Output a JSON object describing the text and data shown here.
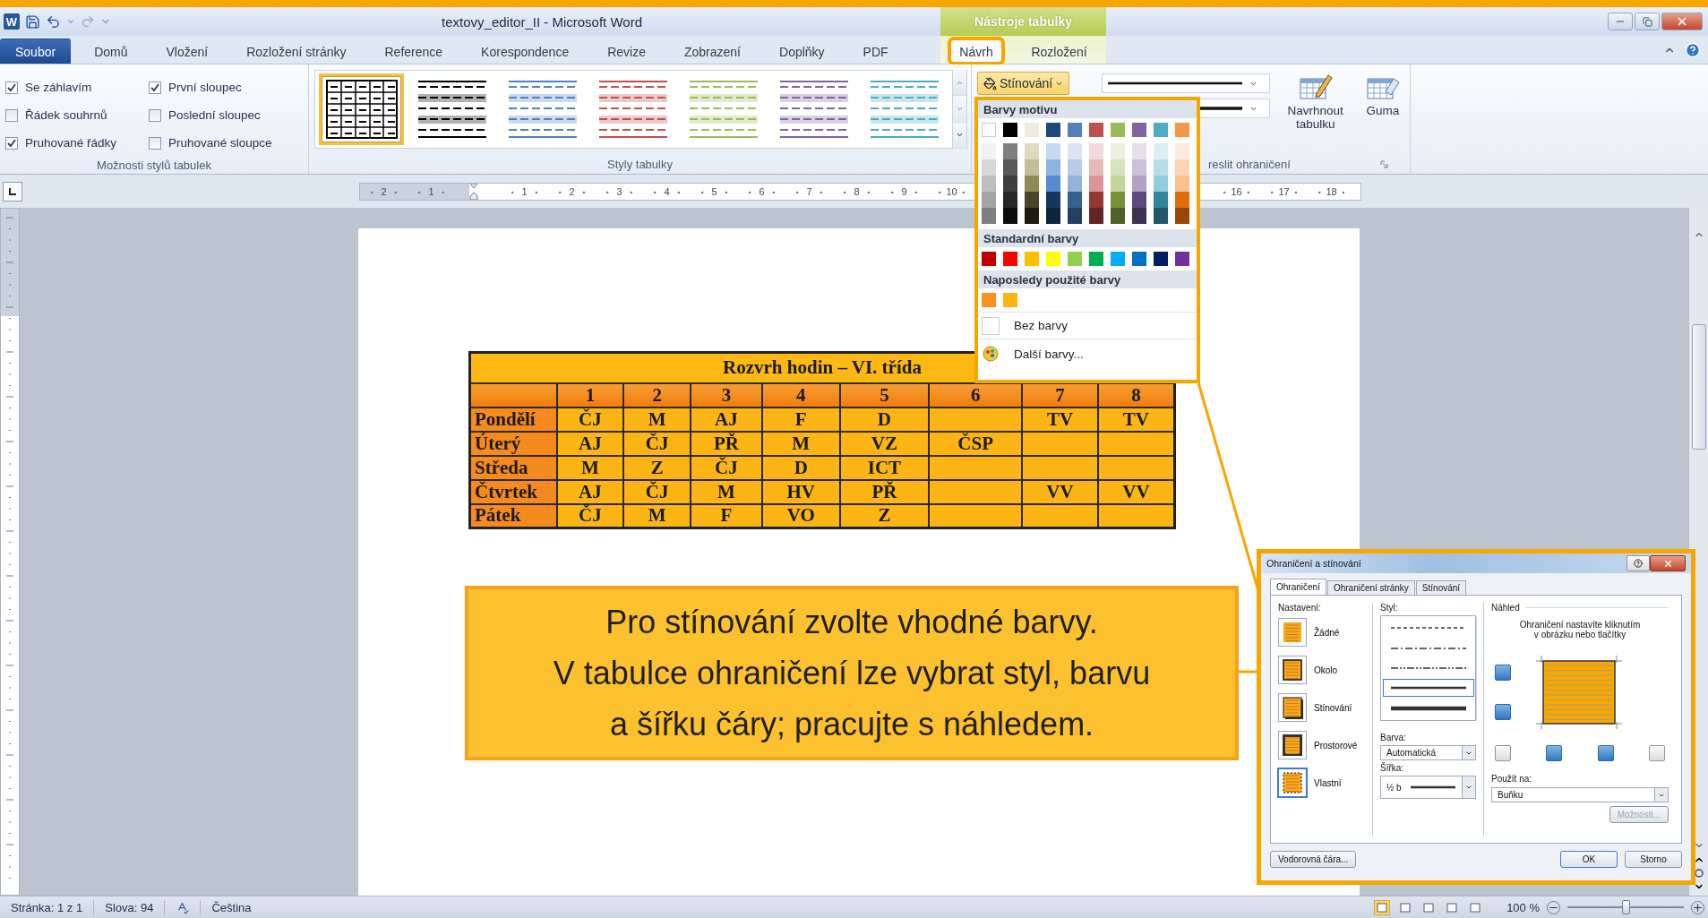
{
  "title_bar": {
    "app_letter": "W",
    "title": "textovy_editor_II - Microsoft Word",
    "context_tab": "Nástroje tabulky"
  },
  "tabs": [
    {
      "label": "Soubor",
      "kind": "file",
      "selected": false,
      "highlighted": false
    },
    {
      "label": "Domů",
      "kind": "main",
      "selected": false,
      "highlighted": false
    },
    {
      "label": "Vložení",
      "kind": "main",
      "selected": false,
      "highlighted": false
    },
    {
      "label": "Rozložení stránky",
      "kind": "main",
      "selected": false,
      "highlighted": false
    },
    {
      "label": "Reference",
      "kind": "main",
      "selected": false,
      "highlighted": false
    },
    {
      "label": "Korespondence",
      "kind": "main",
      "selected": false,
      "highlighted": false
    },
    {
      "label": "Revize",
      "kind": "main",
      "selected": false,
      "highlighted": false
    },
    {
      "label": "Zobrazení",
      "kind": "main",
      "selected": false,
      "highlighted": false
    },
    {
      "label": "Doplňky",
      "kind": "main",
      "selected": false,
      "highlighted": false
    },
    {
      "label": "PDF",
      "kind": "main",
      "selected": false,
      "highlighted": false
    },
    {
      "label": "Návrh",
      "kind": "context",
      "selected": true,
      "highlighted": true
    },
    {
      "label": "Rozložení",
      "kind": "context",
      "selected": false,
      "highlighted": false
    }
  ],
  "ribbon": {
    "style_options": {
      "label": "Možnosti stylů tabulek",
      "options": [
        {
          "label": "Se záhlavím",
          "checked": true
        },
        {
          "label": "Řádek souhrnů",
          "checked": false
        },
        {
          "label": "Pruhované řádky",
          "checked": true
        },
        {
          "label": "První sloupec",
          "checked": true
        },
        {
          "label": "Poslední sloupec",
          "checked": false
        },
        {
          "label": "Pruhované sloupce",
          "checked": false
        }
      ]
    },
    "table_styles": {
      "label": "Styly tabulky",
      "items": [
        {
          "kind": "grid",
          "color": "#000000",
          "selected": true
        },
        {
          "kind": "banded",
          "color": "#000000",
          "selected": false
        },
        {
          "kind": "banded",
          "color": "#4f81bd",
          "selected": false
        },
        {
          "kind": "banded",
          "color": "#c0504d",
          "selected": false
        },
        {
          "kind": "banded",
          "color": "#9bbb59",
          "selected": false
        },
        {
          "kind": "banded",
          "color": "#8064a2",
          "selected": false
        },
        {
          "kind": "banded",
          "color": "#4bacc6",
          "selected": false
        }
      ]
    },
    "borders": {
      "shading_button": {
        "label": "Stínování",
        "open": true
      },
      "buttons": [
        {
          "label": "Navrhnout tabulku",
          "kind": "draw"
        },
        {
          "label": "Guma",
          "kind": "eraser"
        }
      ],
      "label": "reslit ohraničení"
    }
  },
  "ruler": {
    "left_labels": [
      "2",
      "1"
    ],
    "labels": [
      "1",
      "2",
      "3",
      "4",
      "5",
      "6",
      "7",
      "8",
      "9",
      "10"
    ],
    "right_labels": [
      "16",
      "17",
      "18"
    ]
  },
  "document_table": {
    "title": "Rozvrh hodin – VI. třída",
    "columns": [
      "1",
      "2",
      "3",
      "4",
      "5",
      "6",
      "7",
      "8"
    ],
    "rows": [
      {
        "day": "Pondělí",
        "cells": [
          "ČJ",
          "M",
          "AJ",
          "F",
          "D",
          null,
          "TV",
          "TV"
        ]
      },
      {
        "day": "Úterý",
        "cells": [
          "AJ",
          "ČJ",
          "PŘ",
          "M",
          "VZ",
          "ČSP",
          null,
          null
        ]
      },
      {
        "day": "Středa",
        "cells": [
          "M",
          "Z",
          "ČJ",
          "D",
          "ICT",
          null,
          null,
          null
        ]
      },
      {
        "day": "Čtvrtek",
        "cells": [
          "AJ",
          "ČJ",
          "M",
          "HV",
          "PŘ",
          null,
          "VV",
          "VV"
        ]
      },
      {
        "day": "Pátek",
        "cells": [
          "ČJ",
          "M",
          "F",
          "VO",
          "Z",
          null,
          null,
          null
        ]
      }
    ]
  },
  "color_dropdown": {
    "theme_title": "Barvy motivu",
    "theme_colors": [
      {
        "color": "#ffffff",
        "shades": [
          {
            "color": "#f2f2f2"
          },
          {
            "color": "#d8d8d8"
          },
          {
            "color": "#bfbfbf"
          },
          {
            "color": "#a5a5a5"
          },
          {
            "color": "#7f7f7f"
          }
        ]
      },
      {
        "color": "#000000",
        "shades": [
          {
            "color": "#7f7f7f"
          },
          {
            "color": "#595959"
          },
          {
            "color": "#3f3f3f"
          },
          {
            "color": "#262626"
          },
          {
            "color": "#0c0c0c"
          }
        ]
      },
      {
        "color": "#eeece1",
        "shades": [
          {
            "color": "#ddd9c3"
          },
          {
            "color": "#c4bd97"
          },
          {
            "color": "#938953"
          },
          {
            "color": "#494429"
          },
          {
            "color": "#1d1b10"
          }
        ]
      },
      {
        "color": "#1f497d",
        "shades": [
          {
            "color": "#c6d9f0"
          },
          {
            "color": "#8db3e2"
          },
          {
            "color": "#548dd4"
          },
          {
            "color": "#17365d"
          },
          {
            "color": "#0f243e"
          }
        ]
      },
      {
        "color": "#4f81bd",
        "shades": [
          {
            "color": "#dbe5f1"
          },
          {
            "color": "#b8cce4"
          },
          {
            "color": "#95b3d7"
          },
          {
            "color": "#366092"
          },
          {
            "color": "#244061"
          }
        ]
      },
      {
        "color": "#c0504d",
        "shades": [
          {
            "color": "#f2dcdb"
          },
          {
            "color": "#e5b9b7"
          },
          {
            "color": "#d99694"
          },
          {
            "color": "#953734"
          },
          {
            "color": "#632423"
          }
        ]
      },
      {
        "color": "#9bbb59",
        "shades": [
          {
            "color": "#ebf1dd"
          },
          {
            "color": "#d7e3bc"
          },
          {
            "color": "#c3d69b"
          },
          {
            "color": "#76923c"
          },
          {
            "color": "#4f6128"
          }
        ]
      },
      {
        "color": "#8064a2",
        "shades": [
          {
            "color": "#e5e0ec"
          },
          {
            "color": "#ccc1d9"
          },
          {
            "color": "#b2a2c7"
          },
          {
            "color": "#5f497a"
          },
          {
            "color": "#3f3151"
          }
        ]
      },
      {
        "color": "#4bacc6",
        "shades": [
          {
            "color": "#dbeef3"
          },
          {
            "color": "#b7dde8"
          },
          {
            "color": "#92cddc"
          },
          {
            "color": "#31859b"
          },
          {
            "color": "#205867"
          }
        ]
      },
      {
        "color": "#f79646",
        "shades": [
          {
            "color": "#fdeada"
          },
          {
            "color": "#fbd5b5"
          },
          {
            "color": "#fac08f"
          },
          {
            "color": "#e36c09"
          },
          {
            "color": "#974806"
          }
        ]
      }
    ],
    "standard_title": "Standardní barvy",
    "standard_colors": [
      {
        "color": "#c00000"
      },
      {
        "color": "#ff0000"
      },
      {
        "color": "#ffc000"
      },
      {
        "color": "#ffff00"
      },
      {
        "color": "#92d050"
      },
      {
        "color": "#00b050"
      },
      {
        "color": "#00b0f0"
      },
      {
        "color": "#0070c0"
      },
      {
        "color": "#002060"
      },
      {
        "color": "#7030a0"
      }
    ],
    "recent_title": "Naposledy použité barvy",
    "recent_colors": [
      {
        "color": "#f7931e"
      },
      {
        "color": "#fcb614"
      }
    ],
    "items": [
      {
        "label": "Bez barvy",
        "kind": "none"
      },
      {
        "label": "Další barvy...",
        "kind": "more"
      }
    ]
  },
  "callout": {
    "text": "Pro stínování zvolte vhodné barvy.\nV tabulce ohraničení lze vybrat styl, barvu\na šířku čáry; pracujte s náhledem."
  },
  "dialog": {
    "title": "Ohraničení a stínování",
    "tabs": [
      {
        "label": "Ohraničení",
        "selected": true
      },
      {
        "label": "Ohraničení stránky",
        "selected": false
      },
      {
        "label": "Stínování",
        "selected": false
      }
    ],
    "settings_label": "Nastavení:",
    "settings": [
      {
        "label": "Žádné",
        "kind": "none",
        "selected": false
      },
      {
        "label": "Okolo",
        "kind": "box",
        "selected": false
      },
      {
        "label": "Stínování",
        "kind": "shadow",
        "selected": false
      },
      {
        "label": "Prostorové",
        "kind": "raised",
        "selected": false
      },
      {
        "label": "Vlastní",
        "kind": "custom",
        "selected": true
      }
    ],
    "style_label": "Styl:",
    "line_styles": [
      {
        "kind": "dotted",
        "selected": false
      },
      {
        "kind": "dashdot",
        "selected": false
      },
      {
        "kind": "dashdotdot",
        "selected": false
      },
      {
        "kind": "solid",
        "selected": true
      },
      {
        "kind": "thick",
        "selected": false
      }
    ],
    "color_label": "Barva:",
    "color_value": "Automatická",
    "width_label": "Šířka:",
    "width_value": "½ b",
    "preview_label": "Náhled",
    "preview_hint": "Ohraničení nastavíte kliknutím v obrázku nebo tlačítky",
    "apply_label": "Použít na:",
    "apply_value": "Buňku",
    "options_button": {
      "label": "Možnosti...",
      "disabled": true
    },
    "horizontal_line_button": "Vodorovná čára...",
    "ok_button": "OK",
    "cancel_button": "Storno"
  },
  "status_bar": {
    "page": "Stránka: 1 z 1",
    "words": "Slova: 94",
    "language": "Čeština",
    "zoom": "100 %",
    "zoom_slider": {
      "level": 0.5
    }
  }
}
